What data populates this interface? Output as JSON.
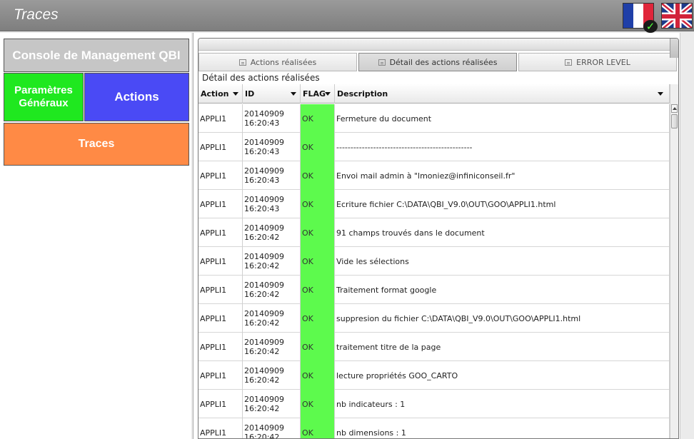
{
  "window": {
    "title": "Traces"
  },
  "languages": [
    {
      "name": "fr-flag-icon",
      "selected": true
    },
    {
      "name": "uk-flag-icon",
      "selected": false
    }
  ],
  "colors": {
    "console": "#c6c6c6",
    "params": "#1fe81f",
    "actions": "#4a4af5",
    "traces": "#ff8a45",
    "flag_ok": "#5dfa4d"
  },
  "nav": {
    "console": "Console de Management QBI",
    "params_line1": "Paramètres",
    "params_line2": "Généraux",
    "actions": "Actions",
    "traces": "Traces"
  },
  "tabs": [
    {
      "label": "Actions réalisées",
      "active": false
    },
    {
      "label": "Détail des actions réalisées",
      "active": true
    },
    {
      "label": "ERROR LEVEL",
      "active": false
    }
  ],
  "caption": "Détail des actions réalisées",
  "columns": {
    "action": "Action",
    "id": "ID",
    "flag": "FLAG",
    "description": "Description"
  },
  "rows": [
    {
      "action": "APPLI1",
      "date": "20140909",
      "time": "16:20:43",
      "flag": "OK",
      "description": "Fermeture du document"
    },
    {
      "action": "APPLI1",
      "date": "20140909",
      "time": "16:20:43",
      "flag": "OK",
      "description": "------------------------------------------------"
    },
    {
      "action": "APPLI1",
      "date": "20140909",
      "time": "16:20:43",
      "flag": "OK",
      "description": "Envoi mail admin à \"lmoniez@infiniconseil.fr\""
    },
    {
      "action": "APPLI1",
      "date": "20140909",
      "time": "16:20:43",
      "flag": "OK",
      "description": "Ecriture fichier C:\\DATA\\QBI_V9.0\\OUT\\GOO\\APPLI1.html"
    },
    {
      "action": "APPLI1",
      "date": "20140909",
      "time": "16:20:42",
      "flag": "OK",
      "description": "91 champs trouvés dans le document"
    },
    {
      "action": "APPLI1",
      "date": "20140909",
      "time": "16:20:42",
      "flag": "OK",
      "description": "Vide les sélections"
    },
    {
      "action": "APPLI1",
      "date": "20140909",
      "time": "16:20:42",
      "flag": "OK",
      "description": "Traitement format google"
    },
    {
      "action": "APPLI1",
      "date": "20140909",
      "time": "16:20:42",
      "flag": "OK",
      "description": "suppresion du fichier C:\\DATA\\QBI_V9.0\\OUT\\GOO\\APPLI1.html"
    },
    {
      "action": "APPLI1",
      "date": "20140909",
      "time": "16:20:42",
      "flag": "OK",
      "description": "traitement titre de la page"
    },
    {
      "action": "APPLI1",
      "date": "20140909",
      "time": "16:20:42",
      "flag": "OK",
      "description": "lecture propriétés GOO_CARTO"
    },
    {
      "action": "APPLI1",
      "date": "20140909",
      "time": "16:20:42",
      "flag": "OK",
      "description": "nb indicateurs : 1"
    },
    {
      "action": "APPLI1",
      "date": "20140909",
      "time": "16:20:42",
      "flag": "OK",
      "description": "nb dimensions : 1"
    }
  ]
}
